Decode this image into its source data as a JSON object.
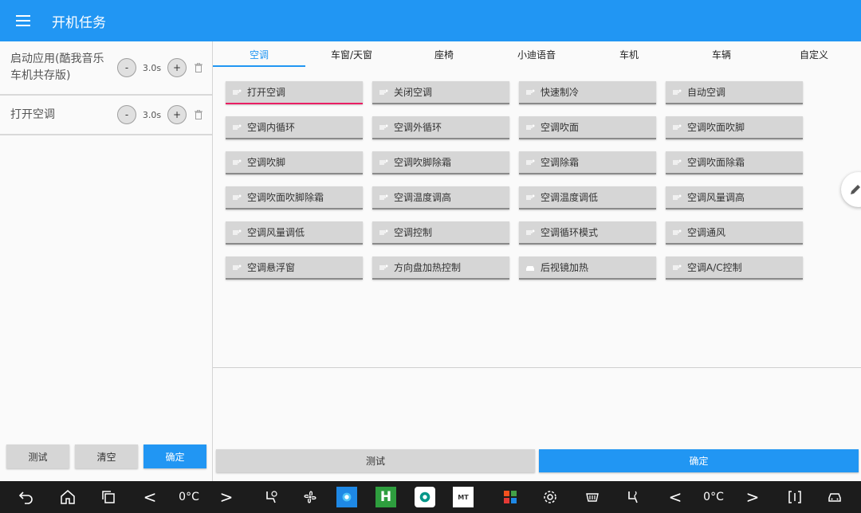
{
  "header": {
    "title": "开机任务"
  },
  "tasks": [
    {
      "label": "启动应用(酷我音乐车机共存版)",
      "minus": "-",
      "duration": "3.0s",
      "plus": "+"
    },
    {
      "label": "打开空调",
      "minus": "-",
      "duration": "3.0s",
      "plus": "+"
    }
  ],
  "left_buttons": {
    "test": "测试",
    "clear": "清空",
    "confirm": "确定"
  },
  "tabs": [
    "空调",
    "车窗/天窗",
    "座椅",
    "小迪语音",
    "车机",
    "车辆",
    "自定义"
  ],
  "active_tab": "空调",
  "actions": [
    "打开空调",
    "关闭空调",
    "快速制冷",
    "自动空调",
    "空调内循环",
    "空调外循环",
    "空调吹面",
    "空调吹面吹脚",
    "空调吹脚",
    "空调吹脚除霜",
    "空调除霜",
    "空调吹面除霜",
    "空调吹面吹脚除霜",
    "空调温度调高",
    "空调温度调低",
    "空调风量调高",
    "空调风量调低",
    "空调控制",
    "空调循环模式",
    "空调通风",
    "空调悬浮窗",
    "方向盘加热控制",
    "后视镜加热",
    "空调A/C控制"
  ],
  "selected_action": "打开空调",
  "bottom_buttons": {
    "test": "测试",
    "confirm": "确定"
  },
  "sysbar": {
    "left_temp": "0°C",
    "right_temp": "0°C",
    "left_arrow": "<",
    "right_arrow": ">",
    "app_h_label": "H",
    "app_mt_label": "MT"
  },
  "colors": {
    "primary": "#2196f3",
    "accent": "#e91e63",
    "sysbar": "#1c1c1c"
  }
}
